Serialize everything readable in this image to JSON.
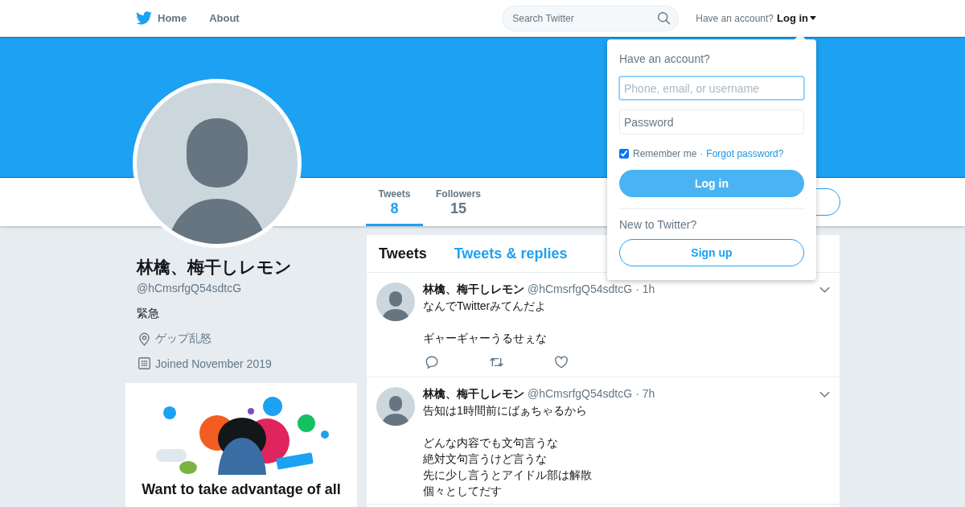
{
  "nav": {
    "items": [
      {
        "label": "Home",
        "kind": "logo"
      },
      {
        "label": "About",
        "kind": "plain"
      }
    ]
  },
  "search": {
    "placeholder": "Search Twitter"
  },
  "login_prompt": {
    "text": "Have an account?",
    "link": "Log in"
  },
  "profile": {
    "name": "林檎、梅干しレモン",
    "handle": "@hCmsrfgQ54sdtcG",
    "bio": "緊急",
    "location": "ゲップ乱怒",
    "joined": "Joined November 2019"
  },
  "stats": [
    {
      "label": "Tweets",
      "value": "8",
      "selected": true
    },
    {
      "label": "Followers",
      "value": "15",
      "selected": false
    }
  ],
  "timeline_tabs": [
    {
      "label": "Tweets",
      "selected": true
    },
    {
      "label": "Tweets & replies",
      "selected": false
    }
  ],
  "tweets": [
    {
      "name": "林檎、梅干しレモン",
      "handle": "@hCmsrfgQ54sdtcG",
      "separator": "·",
      "time": "1h",
      "paragraphs": [
        [
          "なんでTwitterみてんだよ"
        ],
        [
          "ギャーギャーうるせぇな"
        ]
      ],
      "actions": true
    },
    {
      "name": "林檎、梅干しレモン",
      "handle": "@hCmsrfgQ54sdtcG",
      "separator": "·",
      "time": "7h",
      "paragraphs": [
        [
          "告知は1時間前にばぁちゃるから"
        ],
        [
          "どんな内容でも文句言うな",
          "絶対文句言うけど言うな",
          "先に少し言うとアイドル部は解散",
          "個々としてだす"
        ]
      ],
      "actions": false
    }
  ],
  "promo": {
    "title": "Want to take advantage of all"
  },
  "login_dropdown": {
    "heading": "Have an account?",
    "username_placeholder": "Phone, email, or username",
    "username_focused": true,
    "password_placeholder": "Password",
    "remember": {
      "label": "Remember me",
      "checked": true
    },
    "separator": "·",
    "forgot": "Forgot password?",
    "login_button": "Log in",
    "signup_prompt": "New to Twitter?",
    "signup_button": "Sign up"
  }
}
